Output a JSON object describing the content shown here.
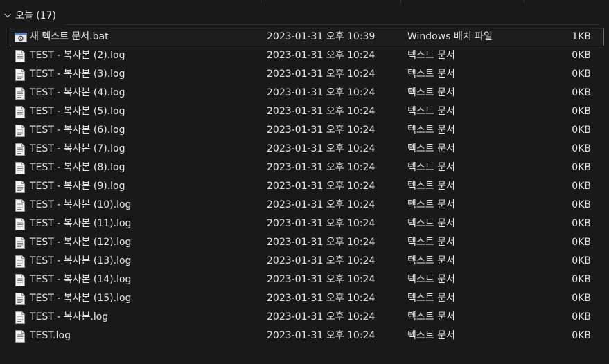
{
  "group": {
    "title": "오늘 (17)"
  },
  "files": [
    {
      "name": "새 텍스트 문서.bat",
      "modified": "2023-01-31 오후 10:39",
      "type": "Windows 배치 파일",
      "size": "1KB",
      "icon": "batch-file-icon",
      "selected": true
    },
    {
      "name": "TEST - 복사본 (2).log",
      "modified": "2023-01-31 오후 10:24",
      "type": "텍스트 문서",
      "size": "0KB",
      "icon": "text-file-icon",
      "selected": false
    },
    {
      "name": "TEST - 복사본 (3).log",
      "modified": "2023-01-31 오후 10:24",
      "type": "텍스트 문서",
      "size": "0KB",
      "icon": "text-file-icon",
      "selected": false
    },
    {
      "name": "TEST - 복사본 (4).log",
      "modified": "2023-01-31 오후 10:24",
      "type": "텍스트 문서",
      "size": "0KB",
      "icon": "text-file-icon",
      "selected": false
    },
    {
      "name": "TEST - 복사본 (5).log",
      "modified": "2023-01-31 오후 10:24",
      "type": "텍스트 문서",
      "size": "0KB",
      "icon": "text-file-icon",
      "selected": false
    },
    {
      "name": "TEST - 복사본 (6).log",
      "modified": "2023-01-31 오후 10:24",
      "type": "텍스트 문서",
      "size": "0KB",
      "icon": "text-file-icon",
      "selected": false
    },
    {
      "name": "TEST - 복사본 (7).log",
      "modified": "2023-01-31 오후 10:24",
      "type": "텍스트 문서",
      "size": "0KB",
      "icon": "text-file-icon",
      "selected": false
    },
    {
      "name": "TEST - 복사본 (8).log",
      "modified": "2023-01-31 오후 10:24",
      "type": "텍스트 문서",
      "size": "0KB",
      "icon": "text-file-icon",
      "selected": false
    },
    {
      "name": "TEST - 복사본 (9).log",
      "modified": "2023-01-31 오후 10:24",
      "type": "텍스트 문서",
      "size": "0KB",
      "icon": "text-file-icon",
      "selected": false
    },
    {
      "name": "TEST - 복사본 (10).log",
      "modified": "2023-01-31 오후 10:24",
      "type": "텍스트 문서",
      "size": "0KB",
      "icon": "text-file-icon",
      "selected": false
    },
    {
      "name": "TEST - 복사본 (11).log",
      "modified": "2023-01-31 오후 10:24",
      "type": "텍스트 문서",
      "size": "0KB",
      "icon": "text-file-icon",
      "selected": false
    },
    {
      "name": "TEST - 복사본 (12).log",
      "modified": "2023-01-31 오후 10:24",
      "type": "텍스트 문서",
      "size": "0KB",
      "icon": "text-file-icon",
      "selected": false
    },
    {
      "name": "TEST - 복사본 (13).log",
      "modified": "2023-01-31 오후 10:24",
      "type": "텍스트 문서",
      "size": "0KB",
      "icon": "text-file-icon",
      "selected": false
    },
    {
      "name": "TEST - 복사본 (14).log",
      "modified": "2023-01-31 오후 10:24",
      "type": "텍스트 문서",
      "size": "0KB",
      "icon": "text-file-icon",
      "selected": false
    },
    {
      "name": "TEST - 복사본 (15).log",
      "modified": "2023-01-31 오후 10:24",
      "type": "텍스트 문서",
      "size": "0KB",
      "icon": "text-file-icon",
      "selected": false
    },
    {
      "name": "TEST - 복사본.log",
      "modified": "2023-01-31 오후 10:24",
      "type": "텍스트 문서",
      "size": "0KB",
      "icon": "text-file-icon",
      "selected": false
    },
    {
      "name": "TEST.log",
      "modified": "2023-01-31 오후 10:24",
      "type": "텍스트 문서",
      "size": "0KB",
      "icon": "text-file-icon",
      "selected": false
    }
  ],
  "colors": {
    "background": "#191919",
    "text": "#e6e6e6",
    "selection_border": "#6b6b6b"
  }
}
